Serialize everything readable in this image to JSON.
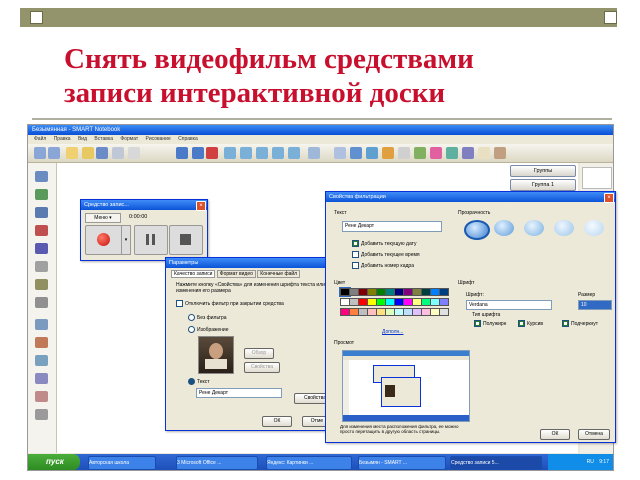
{
  "slide": {
    "title_line1": "Снять видеофильм средствами",
    "title_line2": "записи интерактивной доски"
  },
  "window": {
    "title": "Безымянная - SMART Notebook",
    "menu": [
      "Файл",
      "Правка",
      "Вид",
      "Вставка",
      "Формат",
      "Рисование",
      "Справка"
    ]
  },
  "right_panel": {
    "group_button": "Группы",
    "group1_button": "Группа 1"
  },
  "recorder": {
    "title": "Средство запис...",
    "menu_label": "Меню ▾",
    "time": "0:00:00"
  },
  "params": {
    "title": "Параметры",
    "tabs": [
      "Качество записи",
      "Формат видео",
      "Конечные файл"
    ],
    "hint": "Нажмите кнопку «Свойства» для изменения шрифта текста или изменения его размера",
    "disable_wm": "Отключить фильтр при закрытии средства",
    "opt_none": "Без фильтра",
    "opt_image": "Изображение",
    "btn_browse": "Обзор",
    "btn_props_img": "Свойства",
    "opt_text": "Текст",
    "text_value": "Рене Декарт",
    "btn_props": "Свойства",
    "btn_ok": "ОК",
    "btn_cancel": "Отме"
  },
  "wm": {
    "title": "Свойства фильтрации",
    "text_label": "Текст",
    "text_value": "Рене Декарт",
    "add_date": "Добавить текущую дату",
    "add_time": "Добавить текущее время",
    "add_frame": "Добавить номер кадра",
    "transparency": "Прозрачность",
    "color_label": "Цвет",
    "more_colors": "Дополн...",
    "font_group": "Шрифт",
    "font_label": "Шрифт:",
    "font_value": "Verdana",
    "size_label": "Размер",
    "size_value": "10",
    "style_label": "Тип шрифта",
    "bold": "Полужирн",
    "italic": "Курсив",
    "underline": "Подчеркнут",
    "preview_label": "Просмот",
    "drag_hint": "Для изменения места расположения фильтра, ее можно просто перетащить в другую область страницы.",
    "btn_ok": "ОК",
    "btn_cancel": "Отмена"
  },
  "taskbar": {
    "start": "пуск",
    "items": [
      "Авторская школа",
      "3 Microsoft Office ...",
      "Яндекс: Картинки ...",
      "Безымян - SMART ...",
      "Средство записи 5..."
    ],
    "tray_lang": "RU",
    "clock": "9:17"
  },
  "colors": {
    "title_red": "#c8102e",
    "xp_blue": "#0a4fd6",
    "slide_bar": "#94946c",
    "palette": [
      "#000000",
      "#7f7f7f",
      "#7f0000",
      "#7f7f00",
      "#007f00",
      "#007f7f",
      "#00007f",
      "#7f007f",
      "#7f7f3f",
      "#003f3f",
      "#007fff",
      "#003f7f",
      "#ffffff",
      "#c0c0c0",
      "#ff0000",
      "#ffff00",
      "#00ff00",
      "#00ffff",
      "#0000ff",
      "#ff00ff",
      "#ffff7f",
      "#00ff7f",
      "#7fffff",
      "#7f7fff",
      "#ff007f",
      "#ff7f3f",
      "#bfbfbf",
      "#ffbfbf",
      "#ffdf7f",
      "#dfffbf",
      "#bfffff",
      "#bfdfff",
      "#dfbfff",
      "#ffbfdf",
      "#ffffbf",
      "#e0e0e0"
    ]
  }
}
